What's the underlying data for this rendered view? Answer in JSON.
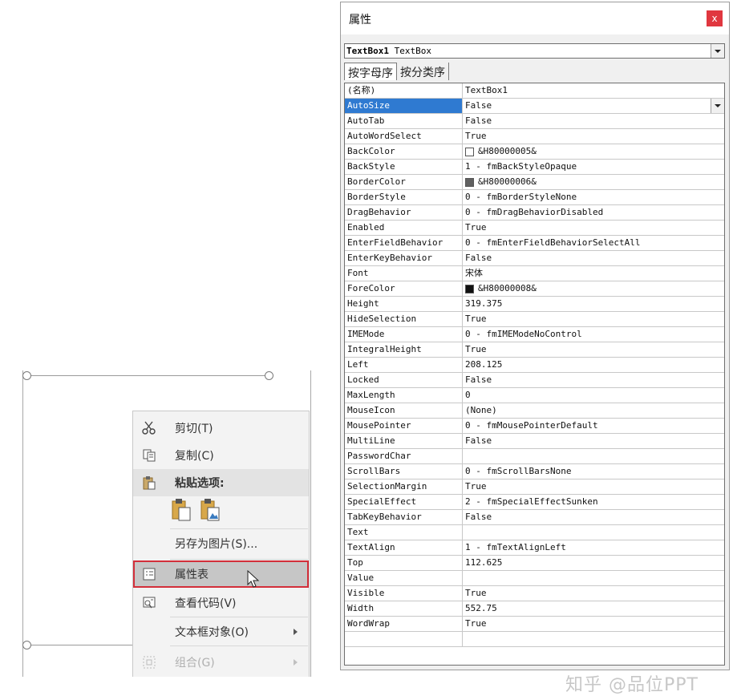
{
  "context_menu": {
    "items": [
      {
        "label": "剪切(T)",
        "icon": "scissors-icon"
      },
      {
        "label": "复制(C)",
        "icon": "copy-icon"
      },
      {
        "label": "粘贴选项:",
        "icon": "paste-icon"
      },
      {
        "label": "另存为图片(S)...",
        "icon": ""
      },
      {
        "label": "属性表",
        "icon": "property-sheet-icon"
      },
      {
        "label": "查看代码(V)",
        "icon": "view-code-icon"
      },
      {
        "label": "文本框对象(O)",
        "icon": ""
      },
      {
        "label": "组合(G)",
        "icon": "group-icon"
      }
    ],
    "selected_color": "#d32f3a"
  },
  "properties": {
    "title": "属性",
    "close_label": "x",
    "object_name": "TextBox1",
    "object_type": "TextBox",
    "tabs": [
      "按字母序",
      "按分类序"
    ],
    "rows": [
      {
        "name": "(名称)",
        "value": "TextBox1"
      },
      {
        "name": "AutoSize",
        "value": "False"
      },
      {
        "name": "AutoTab",
        "value": "False"
      },
      {
        "name": "AutoWordSelect",
        "value": "True"
      },
      {
        "name": "BackColor",
        "value": "&H80000005&",
        "swatch": "#ffffff"
      },
      {
        "name": "BackStyle",
        "value": "1 - fmBackStyleOpaque"
      },
      {
        "name": "BorderColor",
        "value": "&H80000006&",
        "swatch": "#606060"
      },
      {
        "name": "BorderStyle",
        "value": "0 - fmBorderStyleNone"
      },
      {
        "name": "DragBehavior",
        "value": "0 - fmDragBehaviorDisabled"
      },
      {
        "name": "Enabled",
        "value": "True"
      },
      {
        "name": "EnterFieldBehavior",
        "value": "0 - fmEnterFieldBehaviorSelectAll"
      },
      {
        "name": "EnterKeyBehavior",
        "value": "False"
      },
      {
        "name": "Font",
        "value": "宋体"
      },
      {
        "name": "ForeColor",
        "value": "&H80000008&",
        "swatch": "#111111"
      },
      {
        "name": "Height",
        "value": "319.375"
      },
      {
        "name": "HideSelection",
        "value": "True"
      },
      {
        "name": "IMEMode",
        "value": "0 - fmIMEModeNoControl"
      },
      {
        "name": "IntegralHeight",
        "value": "True"
      },
      {
        "name": "Left",
        "value": "208.125"
      },
      {
        "name": "Locked",
        "value": "False"
      },
      {
        "name": "MaxLength",
        "value": "0"
      },
      {
        "name": "MouseIcon",
        "value": "(None)"
      },
      {
        "name": "MousePointer",
        "value": "0 - fmMousePointerDefault"
      },
      {
        "name": "MultiLine",
        "value": "False"
      },
      {
        "name": "PasswordChar",
        "value": ""
      },
      {
        "name": "ScrollBars",
        "value": "0 - fmScrollBarsNone"
      },
      {
        "name": "SelectionMargin",
        "value": "True"
      },
      {
        "name": "SpecialEffect",
        "value": "2 - fmSpecialEffectSunken"
      },
      {
        "name": "TabKeyBehavior",
        "value": "False"
      },
      {
        "name": "Text",
        "value": ""
      },
      {
        "name": "TextAlign",
        "value": "1 - fmTextAlignLeft"
      },
      {
        "name": "Top",
        "value": "112.625"
      },
      {
        "name": "Value",
        "value": ""
      },
      {
        "name": "Visible",
        "value": "True"
      },
      {
        "name": "Width",
        "value": "552.75"
      },
      {
        "name": "WordWrap",
        "value": "True"
      }
    ],
    "selected_row": "AutoSize",
    "selection_color": "#2f7ad1"
  },
  "watermark": "知乎 @品位PPT"
}
